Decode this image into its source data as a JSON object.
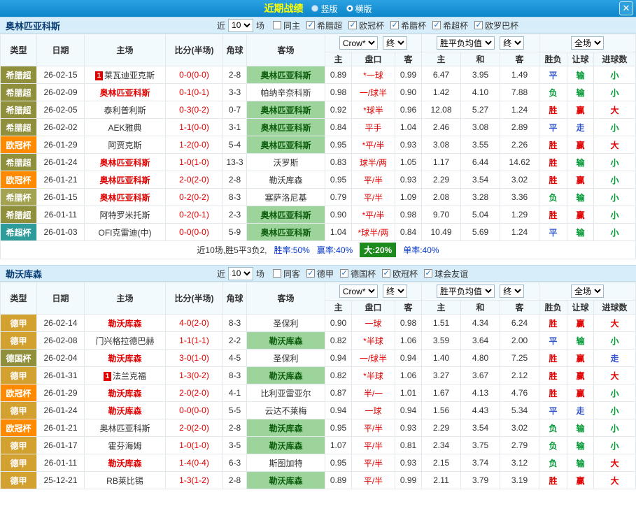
{
  "topbar": {
    "title": "近期战绩",
    "radios": [
      {
        "label": "竖版",
        "selected": false
      },
      {
        "label": "横版",
        "selected": true
      }
    ],
    "close_label": "✕"
  },
  "filter_labels": {
    "recent_prefix": "近",
    "recent_value": "10",
    "recent_suffix": "场"
  },
  "dropdowns": {
    "company": "Crow*",
    "final_a": "终",
    "avg": "胜平负均值",
    "final_b": "终",
    "scope": "全场"
  },
  "columns": {
    "type": "类型",
    "date": "日期",
    "home": "主场",
    "score": "比分(半场)",
    "corner": "角球",
    "away": "客场",
    "asian_home": "主",
    "handicap": "盘口",
    "asian_away": "客",
    "euro_home": "主",
    "euro_draw": "和",
    "euro_away": "客",
    "result": "胜负",
    "handicap_result": "让球",
    "goals": "进球数"
  },
  "league_colors": {
    "希腊超": "#8f8f3c",
    "欧冠杯": "#ff8a00",
    "希腊杯": "#a3a352",
    "希超杯": "#2f9c9c",
    "德甲": "#d2a12f",
    "德国杯": "#8f8f3c"
  },
  "result_colors": {
    "胜": "#e10000",
    "平": "#3355cc",
    "负": "#009933",
    "赢": "#e10000",
    "走": "#3355cc",
    "输": "#009933",
    "大": "#e10000",
    "小": "#009933"
  },
  "sections": [
    {
      "team": "奥林匹亚科斯",
      "checkboxes": [
        {
          "label": "同主",
          "checked": false
        },
        {
          "label": "希腊超",
          "checked": true
        },
        {
          "label": "欧冠杯",
          "checked": true
        },
        {
          "label": "希腊杯",
          "checked": true
        },
        {
          "label": "希超杯",
          "checked": true
        },
        {
          "label": "欧罗巴杯",
          "checked": true
        }
      ],
      "rows": [
        {
          "league": "希腊超",
          "date": "26-02-15",
          "home": "莱瓦迪亚克斯",
          "home_badge": "1",
          "home_focus": false,
          "score": "0-0(0-0)",
          "corner": "2-8",
          "away": "奥林匹亚科斯",
          "away_focus": true,
          "asian_home": "0.89",
          "handicap": "*一球",
          "asian_away": "0.99",
          "euro_home": "6.47",
          "euro_draw": "3.95",
          "euro_away": "1.49",
          "result": "平",
          "handicap_result": "输",
          "goals": "小"
        },
        {
          "league": "希腊超",
          "date": "26-02-09",
          "home": "奥林匹亚科斯",
          "home_focus": true,
          "score": "0-1(0-1)",
          "corner": "3-3",
          "away": "帕纳辛奈科斯",
          "away_focus": false,
          "asian_home": "0.98",
          "handicap": "一/球半",
          "asian_away": "0.90",
          "euro_home": "1.42",
          "euro_draw": "4.10",
          "euro_away": "7.88",
          "result": "负",
          "handicap_result": "输",
          "goals": "小"
        },
        {
          "league": "希腊超",
          "date": "26-02-05",
          "home": "泰利普利斯",
          "home_focus": false,
          "score": "0-3(0-2)",
          "corner": "0-7",
          "away": "奥林匹亚科斯",
          "away_focus": true,
          "asian_home": "0.92",
          "handicap": "*球半",
          "asian_away": "0.96",
          "euro_home": "12.08",
          "euro_draw": "5.27",
          "euro_away": "1.24",
          "result": "胜",
          "handicap_result": "赢",
          "goals": "大"
        },
        {
          "league": "希腊超",
          "date": "26-02-02",
          "home": "AEK雅典",
          "home_focus": false,
          "score": "1-1(0-0)",
          "corner": "3-1",
          "away": "奥林匹亚科斯",
          "away_focus": true,
          "asian_home": "0.84",
          "handicap": "平手",
          "asian_away": "1.04",
          "euro_home": "2.46",
          "euro_draw": "3.08",
          "euro_away": "2.89",
          "result": "平",
          "handicap_result": "走",
          "goals": "小"
        },
        {
          "league": "欧冠杯",
          "date": "26-01-29",
          "home": "阿贾克斯",
          "home_focus": false,
          "score": "1-2(0-0)",
          "corner": "5-4",
          "away": "奥林匹亚科斯",
          "away_focus": true,
          "asian_home": "0.95",
          "handicap": "*平/半",
          "asian_away": "0.93",
          "euro_home": "3.08",
          "euro_draw": "3.55",
          "euro_away": "2.26",
          "result": "胜",
          "handicap_result": "赢",
          "goals": "大"
        },
        {
          "league": "希腊超",
          "date": "26-01-24",
          "home": "奥林匹亚科斯",
          "home_focus": true,
          "score": "1-0(1-0)",
          "corner": "13-3",
          "away": "沃罗斯",
          "away_focus": false,
          "asian_home": "0.83",
          "handicap": "球半/两",
          "asian_away": "1.05",
          "euro_home": "1.17",
          "euro_draw": "6.44",
          "euro_away": "14.62",
          "result": "胜",
          "handicap_result": "输",
          "goals": "小"
        },
        {
          "league": "欧冠杯",
          "date": "26-01-21",
          "home": "奥林匹亚科斯",
          "home_focus": true,
          "score": "2-0(2-0)",
          "corner": "2-8",
          "away": "勒沃库森",
          "away_focus": false,
          "asian_home": "0.95",
          "handicap": "平/半",
          "asian_away": "0.93",
          "euro_home": "2.29",
          "euro_draw": "3.54",
          "euro_away": "3.02",
          "result": "胜",
          "handicap_result": "赢",
          "goals": "小"
        },
        {
          "league": "希腊杯",
          "date": "26-01-15",
          "home": "奥林匹亚科斯",
          "home_focus": true,
          "score": "0-2(0-2)",
          "corner": "8-3",
          "away": "塞萨洛尼基",
          "away_focus": false,
          "asian_home": "0.79",
          "handicap": "平/半",
          "asian_away": "1.09",
          "euro_home": "2.08",
          "euro_draw": "3.28",
          "euro_away": "3.36",
          "result": "负",
          "handicap_result": "输",
          "goals": "小"
        },
        {
          "league": "希腊超",
          "date": "26-01-11",
          "home": "阿特罗米托斯",
          "home_focus": false,
          "score": "0-2(0-1)",
          "corner": "2-3",
          "away": "奥林匹亚科斯",
          "away_focus": true,
          "asian_home": "0.90",
          "handicap": "*平/半",
          "asian_away": "0.98",
          "euro_home": "9.70",
          "euro_draw": "5.04",
          "euro_away": "1.29",
          "result": "胜",
          "handicap_result": "赢",
          "goals": "小"
        },
        {
          "league": "希超杯",
          "date": "26-01-03",
          "home": "OFI克雷迪(中)",
          "home_focus": false,
          "score": "0-0(0-0)",
          "corner": "5-9",
          "away": "奥林匹亚科斯",
          "away_focus": true,
          "asian_home": "1.04",
          "handicap": "*球半/两",
          "asian_away": "0.84",
          "euro_home": "10.49",
          "euro_draw": "5.69",
          "euro_away": "1.24",
          "result": "平",
          "handicap_result": "输",
          "goals": "小"
        }
      ],
      "summary": {
        "prefix": "近10场,胜5平3负2,",
        "stats": [
          {
            "text": "胜率:50%",
            "highlight": false
          },
          {
            "text": "赢率:40%",
            "highlight": false
          },
          {
            "text": "大:20%",
            "highlight": true
          },
          {
            "text": "单率:40%",
            "highlight": false
          }
        ]
      }
    },
    {
      "team": "勒沃库森",
      "checkboxes": [
        {
          "label": "同客",
          "checked": false
        },
        {
          "label": "德甲",
          "checked": true
        },
        {
          "label": "德国杯",
          "checked": true
        },
        {
          "label": "欧冠杯",
          "checked": true
        },
        {
          "label": "球会友谊",
          "checked": true
        }
      ],
      "rows": [
        {
          "league": "德甲",
          "date": "26-02-14",
          "home": "勒沃库森",
          "home_focus": true,
          "score": "4-0(2-0)",
          "corner": "8-3",
          "away": "圣保利",
          "away_focus": false,
          "asian_home": "0.90",
          "handicap": "一球",
          "asian_away": "0.98",
          "euro_home": "1.51",
          "euro_draw": "4.34",
          "euro_away": "6.24",
          "result": "胜",
          "handicap_result": "赢",
          "goals": "大"
        },
        {
          "league": "德甲",
          "date": "26-02-08",
          "home": "门兴格拉德巴赫",
          "home_focus": false,
          "score": "1-1(1-1)",
          "corner": "2-2",
          "away": "勒沃库森",
          "away_focus": true,
          "asian_home": "0.82",
          "handicap": "*半球",
          "asian_away": "1.06",
          "euro_home": "3.59",
          "euro_draw": "3.64",
          "euro_away": "2.00",
          "result": "平",
          "handicap_result": "输",
          "goals": "小"
        },
        {
          "league": "德国杯",
          "date": "26-02-04",
          "home": "勒沃库森",
          "home_focus": true,
          "score": "3-0(1-0)",
          "corner": "4-5",
          "away": "圣保利",
          "away_focus": false,
          "asian_home": "0.94",
          "handicap": "一/球半",
          "asian_away": "0.94",
          "euro_home": "1.40",
          "euro_draw": "4.80",
          "euro_away": "7.25",
          "result": "胜",
          "handicap_result": "赢",
          "goals": "走"
        },
        {
          "league": "德甲",
          "date": "26-01-31",
          "home": "法兰克福",
          "home_badge": "1",
          "home_focus": false,
          "score": "1-3(0-2)",
          "corner": "8-3",
          "away": "勒沃库森",
          "away_focus": true,
          "asian_home": "0.82",
          "handicap": "*半球",
          "asian_away": "1.06",
          "euro_home": "3.27",
          "euro_draw": "3.67",
          "euro_away": "2.12",
          "result": "胜",
          "handicap_result": "赢",
          "goals": "大"
        },
        {
          "league": "欧冠杯",
          "date": "26-01-29",
          "home": "勒沃库森",
          "home_focus": true,
          "score": "2-0(2-0)",
          "corner": "4-1",
          "away": "比利亚雷亚尔",
          "away_focus": false,
          "asian_home": "0.87",
          "handicap": "半/一",
          "asian_away": "1.01",
          "euro_home": "1.67",
          "euro_draw": "4.13",
          "euro_away": "4.76",
          "result": "胜",
          "handicap_result": "赢",
          "goals": "小"
        },
        {
          "league": "德甲",
          "date": "26-01-24",
          "home": "勒沃库森",
          "home_focus": true,
          "score": "0-0(0-0)",
          "corner": "5-5",
          "away": "云达不莱梅",
          "away_focus": false,
          "asian_home": "0.94",
          "handicap": "一球",
          "asian_away": "0.94",
          "euro_home": "1.56",
          "euro_draw": "4.43",
          "euro_away": "5.34",
          "result": "平",
          "handicap_result": "走",
          "goals": "小"
        },
        {
          "league": "欧冠杯",
          "date": "26-01-21",
          "home": "奥林匹亚科斯",
          "home_focus": false,
          "score": "2-0(2-0)",
          "corner": "2-8",
          "away": "勒沃库森",
          "away_focus": true,
          "asian_home": "0.95",
          "handicap": "平/半",
          "asian_away": "0.93",
          "euro_home": "2.29",
          "euro_draw": "3.54",
          "euro_away": "3.02",
          "result": "负",
          "handicap_result": "输",
          "goals": "小"
        },
        {
          "league": "德甲",
          "date": "26-01-17",
          "home": "霍芬海姆",
          "home_focus": false,
          "score": "1-0(1-0)",
          "corner": "3-5",
          "away": "勒沃库森",
          "away_focus": true,
          "asian_home": "1.07",
          "handicap": "平/半",
          "asian_away": "0.81",
          "euro_home": "2.34",
          "euro_draw": "3.75",
          "euro_away": "2.79",
          "result": "负",
          "handicap_result": "输",
          "goals": "小"
        },
        {
          "league": "德甲",
          "date": "26-01-11",
          "home": "勒沃库森",
          "home_focus": true,
          "score": "1-4(0-4)",
          "corner": "6-3",
          "away": "斯图加特",
          "away_focus": false,
          "asian_home": "0.95",
          "handicap": "平/半",
          "asian_away": "0.93",
          "euro_home": "2.15",
          "euro_draw": "3.74",
          "euro_away": "3.12",
          "result": "负",
          "handicap_result": "输",
          "goals": "大"
        },
        {
          "league": "德甲",
          "date": "25-12-21",
          "home": "RB莱比锡",
          "home_focus": false,
          "score": "1-3(1-2)",
          "corner": "2-8",
          "away": "勒沃库森",
          "away_focus": true,
          "asian_home": "0.89",
          "handicap": "平/半",
          "asian_away": "0.99",
          "euro_home": "2.11",
          "euro_draw": "3.79",
          "euro_away": "3.19",
          "result": "胜",
          "handicap_result": "赢",
          "goals": "大"
        }
      ],
      "summary": null
    }
  ]
}
